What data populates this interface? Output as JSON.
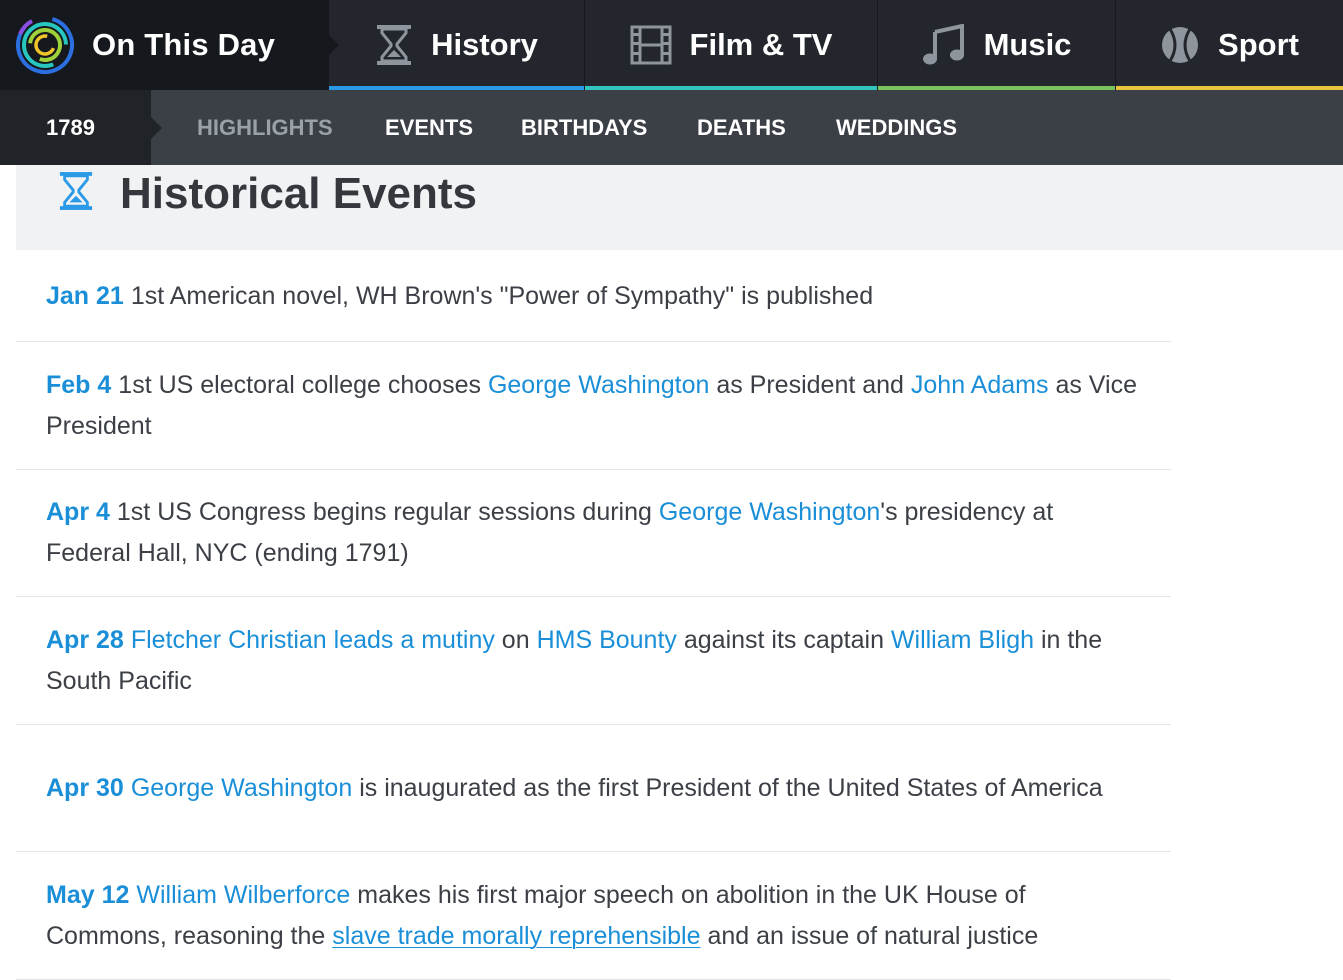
{
  "brand": {
    "title": "On This Day"
  },
  "nav_tabs": [
    {
      "label": "History",
      "icon": "hourglass-icon",
      "accent": "#2b9ae6"
    },
    {
      "label": "Film & TV",
      "icon": "film-icon",
      "accent": "#32c5c0"
    },
    {
      "label": "Music",
      "icon": "music-note-icon",
      "accent": "#7ac35c"
    },
    {
      "label": "Sport",
      "icon": "ball-icon",
      "accent": "#e8c43a"
    }
  ],
  "subnav": {
    "year": "1789",
    "links": [
      "HIGHLIGHTS",
      "EVENTS",
      "BIRTHDAYS",
      "DEATHS",
      "WEDDINGS"
    ],
    "active": "HIGHLIGHTS"
  },
  "section": {
    "title": "Historical Events",
    "icon": "hourglass-icon",
    "icon_color": "#2b9ae6"
  },
  "colors": {
    "link": "#1a8fd8",
    "text": "#3c4046",
    "topnav_bg": "#23272d",
    "subnav_bg": "#3b4047",
    "section_bg": "#f1f2f4"
  },
  "events": [
    {
      "date": "Jan 21",
      "parts": [
        {
          "text": "1st American novel, WH Brown's \"Power of Sympathy\" is published",
          "link": false
        }
      ]
    },
    {
      "date": "Feb 4",
      "parts": [
        {
          "text": "1st US electoral college chooses ",
          "link": false
        },
        {
          "text": "George Washington",
          "link": true
        },
        {
          "text": " as President and ",
          "link": false
        },
        {
          "text": "John Adams",
          "link": true
        },
        {
          "text": " as Vice President",
          "link": false
        }
      ]
    },
    {
      "date": "Apr 4",
      "parts": [
        {
          "text": "1st US Congress begins regular sessions during ",
          "link": false
        },
        {
          "text": "George Washington",
          "link": true
        },
        {
          "text": "'s presidency at Federal Hall, NYC (ending 1791)",
          "link": false
        }
      ]
    },
    {
      "date": "Apr 28",
      "parts": [
        {
          "text": "Fletcher Christian leads a mutiny",
          "link": true
        },
        {
          "text": " on ",
          "link": false
        },
        {
          "text": "HMS Bounty",
          "link": true
        },
        {
          "text": " against its captain ",
          "link": false
        },
        {
          "text": "William Bligh",
          "link": true
        },
        {
          "text": " in the South Pacific",
          "link": false
        }
      ]
    },
    {
      "date": "Apr 30",
      "parts": [
        {
          "text": "George Washington",
          "link": true
        },
        {
          "text": " is inaugurated as the first President of the United States of America",
          "link": false
        }
      ]
    },
    {
      "date": "May 12",
      "parts": [
        {
          "text": "William Wilberforce",
          "link": true
        },
        {
          "text": " makes his first major speech on abolition in the UK House of Commons, reasoning the ",
          "link": false
        },
        {
          "text": "slave trade morally reprehensible",
          "link": true,
          "underline": true
        },
        {
          "text": " and an issue of natural justice",
          "link": false
        }
      ]
    }
  ]
}
